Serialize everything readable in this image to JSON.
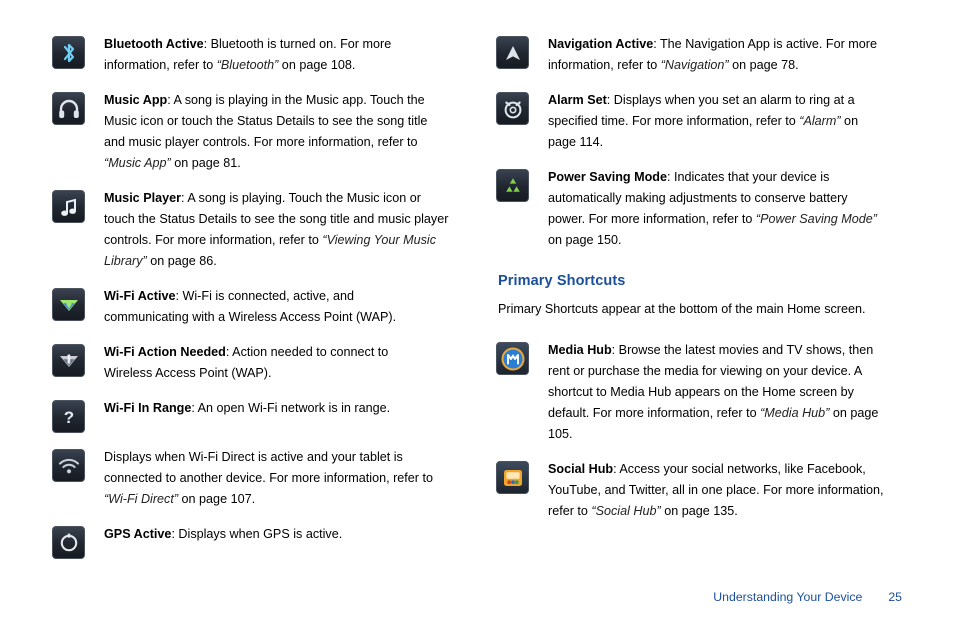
{
  "left_column": [
    {
      "icon": "bluetooth-active-icon",
      "parts": [
        {
          "t": "Bluetooth Active",
          "s": "b"
        },
        {
          "t": ": Bluetooth is turned on. For more information, refer to ",
          "s": "n"
        },
        {
          "t": "“Bluetooth”",
          "s": "i"
        },
        {
          "t": "  on page 108.",
          "s": "n"
        }
      ]
    },
    {
      "icon": "music-app-headphones-icon",
      "parts": [
        {
          "t": "Music App",
          "s": "b"
        },
        {
          "t": ": A song is playing in the Music app. Touch the Music icon or touch the Status Details to see the song title and music player controls. For more information, refer to ",
          "s": "n"
        },
        {
          "t": "“Music App”",
          "s": "i"
        },
        {
          "t": "  on page 81.",
          "s": "n"
        }
      ]
    },
    {
      "icon": "music-player-note-icon",
      "parts": [
        {
          "t": "Music Player",
          "s": "b"
        },
        {
          "t": ": A song is playing. Touch the Music icon or touch the Status Details to see the song title and music player controls. For more information, refer to ",
          "s": "n"
        },
        {
          "t": "“Viewing Your Music Library”",
          "s": "i"
        },
        {
          "t": "  on page 86.",
          "s": "n"
        }
      ]
    },
    {
      "icon": "wifi-active-icon",
      "parts": [
        {
          "t": "Wi-Fi Active",
          "s": "b"
        },
        {
          "t": ": Wi-Fi is connected, active, and communicating with a Wireless Access Point (WAP).",
          "s": "n"
        }
      ]
    },
    {
      "icon": "wifi-action-needed-icon",
      "parts": [
        {
          "t": "Wi-Fi Action Needed",
          "s": "b"
        },
        {
          "t": ": Action needed to connect to Wireless Access Point (WAP).",
          "s": "n"
        }
      ]
    },
    {
      "icon": "wifi-in-range-icon",
      "parts": [
        {
          "t": "Wi-Fi In Range",
          "s": "b"
        },
        {
          "t": ": An open Wi-Fi network is in range.",
          "s": "n"
        }
      ]
    },
    {
      "icon": "wifi-direct-icon",
      "parts": [
        {
          "t": "Displays when Wi-Fi Direct is active and your tablet is connected to another device. For more information, refer to ",
          "s": "n"
        },
        {
          "t": "“Wi-Fi Direct”",
          "s": "i"
        },
        {
          "t": "  on page 107.",
          "s": "n"
        }
      ]
    },
    {
      "icon": "gps-active-icon",
      "parts": [
        {
          "t": "GPS Active",
          "s": "b"
        },
        {
          "t": ": Displays when GPS is active.",
          "s": "n"
        }
      ]
    }
  ],
  "right_column": [
    {
      "icon": "navigation-active-icon",
      "parts": [
        {
          "t": "Navigation Active",
          "s": "b"
        },
        {
          "t": ": The Navigation App is active. For more information, refer to ",
          "s": "n"
        },
        {
          "t": "“Navigation”",
          "s": "i"
        },
        {
          "t": "  on page 78.",
          "s": "n"
        }
      ]
    },
    {
      "icon": "alarm-set-icon",
      "parts": [
        {
          "t": "Alarm Set",
          "s": "b"
        },
        {
          "t": ": Displays when you set an alarm to ring at a specified time. For more information, refer to ",
          "s": "n"
        },
        {
          "t": "“Alarm”",
          "s": "i"
        },
        {
          "t": " on page 114.",
          "s": "n"
        }
      ]
    },
    {
      "icon": "power-saving-mode-recycle-icon",
      "parts": [
        {
          "t": "Power Saving Mode",
          "s": "b"
        },
        {
          "t": ": Indicates that your device is automatically making adjustments to conserve battery power. For more information, refer to ",
          "s": "n"
        },
        {
          "t": "“Power Saving Mode”",
          "s": "i"
        },
        {
          "t": "  on page 150.",
          "s": "n"
        }
      ]
    }
  ],
  "primary_shortcuts": {
    "heading": "Primary Shortcuts",
    "intro": "Primary Shortcuts appear at the bottom of the main Home screen.",
    "items": [
      {
        "icon": "media-hub-icon",
        "parts": [
          {
            "t": "Media Hub",
            "s": "b"
          },
          {
            "t": ": Browse the latest movies and TV shows, then rent or purchase the media for viewing on your device. A shortcut to Media Hub appears on the Home screen by default. For more information, refer to ",
            "s": "n"
          },
          {
            "t": "“Media Hub”",
            "s": "i"
          },
          {
            "t": "  on page 105.",
            "s": "n"
          }
        ]
      },
      {
        "icon": "social-hub-icon",
        "parts": [
          {
            "t": "Social Hub",
            "s": "b"
          },
          {
            "t": ": Access your social networks, like Facebook, YouTube, and Twitter, all in one place. For more information, refer to ",
            "s": "n"
          },
          {
            "t": "“Social Hub”",
            "s": "i"
          },
          {
            "t": "  on page 135.",
            "s": "n"
          }
        ]
      }
    ]
  },
  "footer": {
    "label": "Understanding Your Device",
    "page": "25"
  },
  "colors": {
    "heading": "#1b4f9c",
    "footer": "#1b4f9c",
    "icon_dark": "#20262f"
  }
}
